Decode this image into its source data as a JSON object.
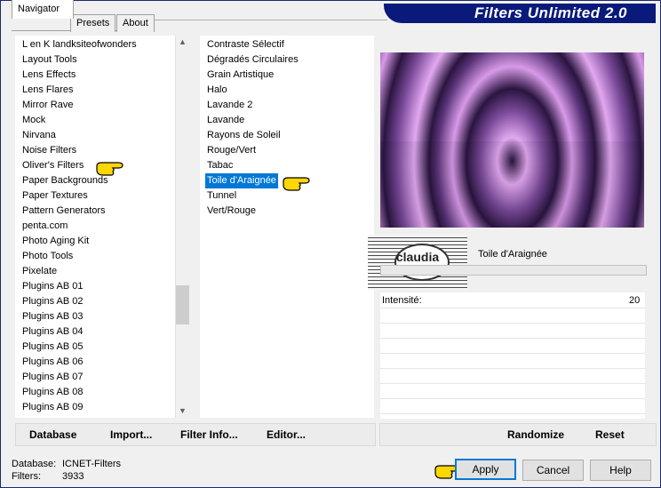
{
  "window": {
    "title": "Filters Unlimited 2.0"
  },
  "tabs": [
    "Navigator",
    "Presets",
    "About"
  ],
  "categories": [
    "L en K landksiteofwonders",
    "Layout Tools",
    "Lens Effects",
    "Lens Flares",
    "Mirror Rave",
    "Mock",
    "Nirvana",
    "Noise Filters",
    "Oliver's Filters",
    "Paper Backgrounds",
    "Paper Textures",
    "Pattern Generators",
    "penta.com",
    "Photo Aging Kit",
    "Photo Tools",
    "Pixelate",
    "Plugins AB 01",
    "Plugins AB 02",
    "Plugins AB 03",
    "Plugins AB 04",
    "Plugins AB 05",
    "Plugins AB 06",
    "Plugins AB 07",
    "Plugins AB 08",
    "Plugins AB 09"
  ],
  "selected_category": "Oliver's Filters",
  "filters": [
    "Contraste Sélectif",
    "Dégradés Circulaires",
    "Grain Artistique",
    "Halo",
    "Lavande 2",
    "Lavande",
    "Rayons de Soleil",
    "Rouge/Vert",
    "Tabac",
    "Toile d'Araignée",
    "Tunnel",
    "Vert/Rouge"
  ],
  "selected_filter": "Toile d'Araignée",
  "filter_title": "Toile d'Araignée",
  "logo_text": "claudia",
  "param": {
    "label": "Intensité:",
    "value": "20"
  },
  "buttons_left": {
    "database": "Database",
    "import": "Import...",
    "filter_info": "Filter Info...",
    "editor": "Editor..."
  },
  "buttons_right": {
    "randomize": "Randomize",
    "reset": "Reset"
  },
  "info": {
    "database_label": "Database:",
    "database_value": "ICNET-Filters",
    "filters_label": "Filters:",
    "filters_value": "3933"
  },
  "dialog_buttons": {
    "apply": "Apply",
    "cancel": "Cancel",
    "help": "Help"
  },
  "colors": {
    "banner": "#0a1a7a",
    "selection": "#0078d7",
    "preview_light": "#e2a8f0",
    "preview_dark": "#2a1540"
  }
}
